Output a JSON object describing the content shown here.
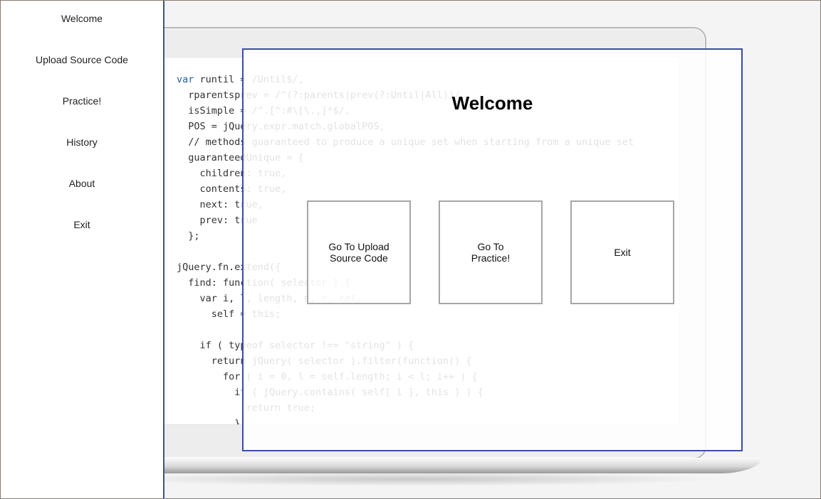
{
  "sidebar": {
    "items": [
      {
        "label": "Welcome"
      },
      {
        "label": "Upload Source Code"
      },
      {
        "label": "Practice!"
      },
      {
        "label": "History"
      },
      {
        "label": "About"
      },
      {
        "label": "Exit"
      }
    ]
  },
  "dialog": {
    "title": "Welcome",
    "buttons": [
      {
        "line1": "Go To Upload",
        "line2": "Source Code"
      },
      {
        "line1": "Go To",
        "line2": "Practice!"
      },
      {
        "line1": "Exit",
        "line2": ""
      }
    ]
  },
  "background_code": {
    "lines": [
      "var runtil = /Until$/,",
      "  rparentsprev = /^(?:parents|prev(?:Until|All))/,",
      "  isSimple = /^.[^:#\\[\\.,]*$/,",
      "  POS = jQuery.expr.match.globalPOS,",
      "  // methods guaranteed to produce a unique set when starting from a unique set",
      "  guaranteedUnique = {",
      "    children: true,",
      "    contents: true,",
      "    next: true,",
      "    prev: true",
      "  };",
      "",
      "jQuery.fn.extend({",
      "  find: function( selector ) {",
      "    var i, l, length, n, r, ret,",
      "      self = this;",
      "",
      "    if ( typeof selector !== \"string\" ) {",
      "      return jQuery( selector ).filter(function() {",
      "        for ( i = 0, l = self.length; i < l; i++ ) {",
      "          if ( jQuery.contains( self[ i ], this ) ) {",
      "            return true;",
      "          }"
    ]
  },
  "colors": {
    "accent_border": "#3b4ea3",
    "tile_border": "#a6a6a6",
    "code_keyword": "#1f5fa8"
  }
}
